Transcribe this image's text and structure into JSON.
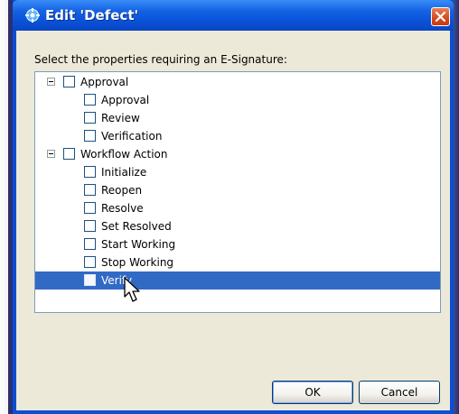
{
  "dialog": {
    "title": "Edit 'Defect'",
    "instruction": "Select the properties requiring an E-Signature:",
    "tree": [
      {
        "label": "Approval",
        "level": 0,
        "expanded": true,
        "checked": false,
        "selected": false
      },
      {
        "label": "Approval",
        "level": 1,
        "checked": false,
        "selected": false
      },
      {
        "label": "Review",
        "level": 1,
        "checked": false,
        "selected": false
      },
      {
        "label": "Verification",
        "level": 1,
        "checked": false,
        "selected": false
      },
      {
        "label": "Workflow Action",
        "level": 0,
        "expanded": true,
        "checked": false,
        "selected": false
      },
      {
        "label": "Initialize",
        "level": 1,
        "checked": false,
        "selected": false
      },
      {
        "label": "Reopen",
        "level": 1,
        "checked": false,
        "selected": false
      },
      {
        "label": "Resolve",
        "level": 1,
        "checked": false,
        "selected": false
      },
      {
        "label": "Set Resolved",
        "level": 1,
        "checked": false,
        "selected": false
      },
      {
        "label": "Start Working",
        "level": 1,
        "checked": false,
        "selected": false
      },
      {
        "label": "Stop Working",
        "level": 1,
        "checked": false,
        "selected": false
      },
      {
        "label": "Verify",
        "level": 1,
        "checked": false,
        "selected": true
      }
    ],
    "buttons": {
      "ok": "OK",
      "cancel": "Cancel"
    }
  },
  "icons": {
    "title": "app-gear-icon",
    "close": "close-icon",
    "expander": "minus-expander-icon",
    "cursor": "mouse-pointer-icon"
  },
  "colors": {
    "titlebar": "#0a51d8",
    "selection": "#316ac5",
    "close": "#d5491d",
    "client": "#ece9d8"
  }
}
